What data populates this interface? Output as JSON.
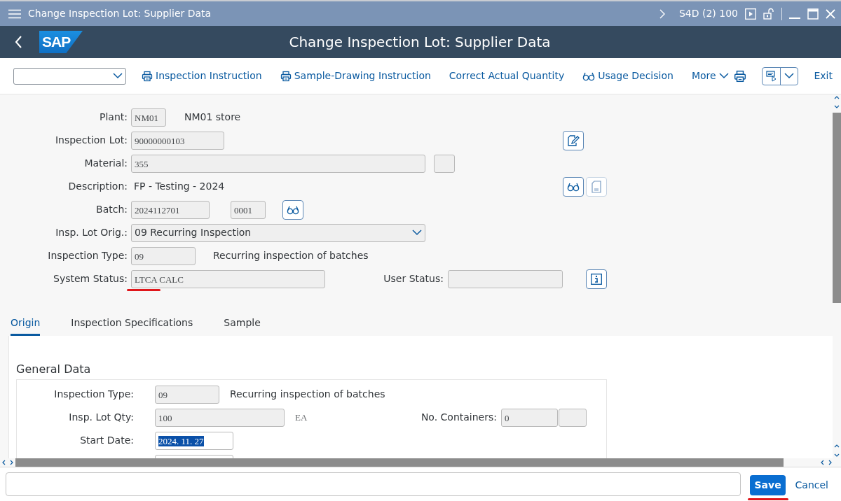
{
  "title_bar": {
    "title": "Change Inspection Lot: Supplier Data",
    "system": "S4D (2) 100"
  },
  "header": {
    "logo": "SAP",
    "title": "Change Inspection Lot: Supplier Data"
  },
  "toolbar": {
    "actions": [
      {
        "label": "Inspection Instruction",
        "kind": "print"
      },
      {
        "label": "Sample-Drawing Instruction",
        "kind": "print"
      },
      {
        "label": "Correct Actual Quantity",
        "kind": "plain"
      },
      {
        "label": "Usage Decision",
        "kind": "glasses"
      },
      {
        "label": "More",
        "kind": "menu"
      }
    ],
    "exit": "Exit"
  },
  "form": {
    "rows": [
      {
        "label": "Plant:",
        "items": [
          {
            "kind": "field",
            "value": "NM01"
          },
          {
            "kind": "text",
            "text": "NM01 store"
          }
        ]
      },
      {
        "label": "Inspection Lot:",
        "items": [
          {
            "kind": "field",
            "value": "90000000103"
          },
          {
            "kind": "edit-button"
          }
        ]
      },
      {
        "label": "Material:",
        "items": [
          {
            "kind": "field",
            "value": "355"
          },
          {
            "kind": "field"
          }
        ]
      },
      {
        "label": "Description:",
        "items": [
          {
            "kind": "text",
            "text": "FP - Testing - 2024"
          },
          {
            "kind": "glasses-button"
          },
          {
            "kind": "doc-button"
          }
        ]
      },
      {
        "label": "Batch:",
        "items": [
          {
            "kind": "field",
            "value": "2024112701"
          },
          {
            "kind": "field",
            "value": "0001"
          },
          {
            "kind": "glasses-button"
          }
        ]
      },
      {
        "label": "Insp. Lot Orig.:",
        "items": [
          {
            "kind": "dropdown",
            "value": "09 Recurring Inspection"
          }
        ]
      },
      {
        "label": "Inspection Type:",
        "items": [
          {
            "kind": "field",
            "value": "09"
          },
          {
            "kind": "text",
            "text": "Recurring inspection of batches"
          }
        ]
      },
      {
        "label": "System Status:",
        "items": [
          {
            "kind": "field",
            "value": "LTCA CALC",
            "underlined": true
          },
          {
            "kind": "label",
            "text": "User Status:"
          },
          {
            "kind": "field"
          },
          {
            "kind": "info-button"
          }
        ]
      }
    ]
  },
  "tabs": [
    {
      "label": "Origin",
      "selected": true
    },
    {
      "label": "Inspection Specifications",
      "selected": false
    },
    {
      "label": "Sample",
      "selected": false
    }
  ],
  "general_data": {
    "title": "General Data",
    "rows": [
      {
        "label": "Inspection Type:",
        "items": [
          {
            "kind": "field",
            "value": "09"
          },
          {
            "kind": "text",
            "text": "Recurring inspection of batches"
          }
        ]
      },
      {
        "label": "Insp. Lot Qty:",
        "items": [
          {
            "kind": "field",
            "value": "100"
          },
          {
            "kind": "unit",
            "text": "EA"
          },
          {
            "kind": "label",
            "text": "No. Containers:"
          },
          {
            "kind": "field",
            "value": "0"
          },
          {
            "kind": "field"
          }
        ]
      },
      {
        "label": "Start Date:",
        "items": [
          {
            "kind": "field",
            "value": "2024. 11. 27",
            "highlighted": true,
            "editable": true
          }
        ]
      },
      {
        "items": [
          {
            "kind": "field",
            "editable": true
          }
        ]
      }
    ]
  },
  "footer": {
    "buttons": [
      {
        "label": "Save",
        "kind": "primary",
        "underlined": true
      },
      {
        "label": "Cancel",
        "kind": "plain",
        "underlined": false
      }
    ]
  }
}
